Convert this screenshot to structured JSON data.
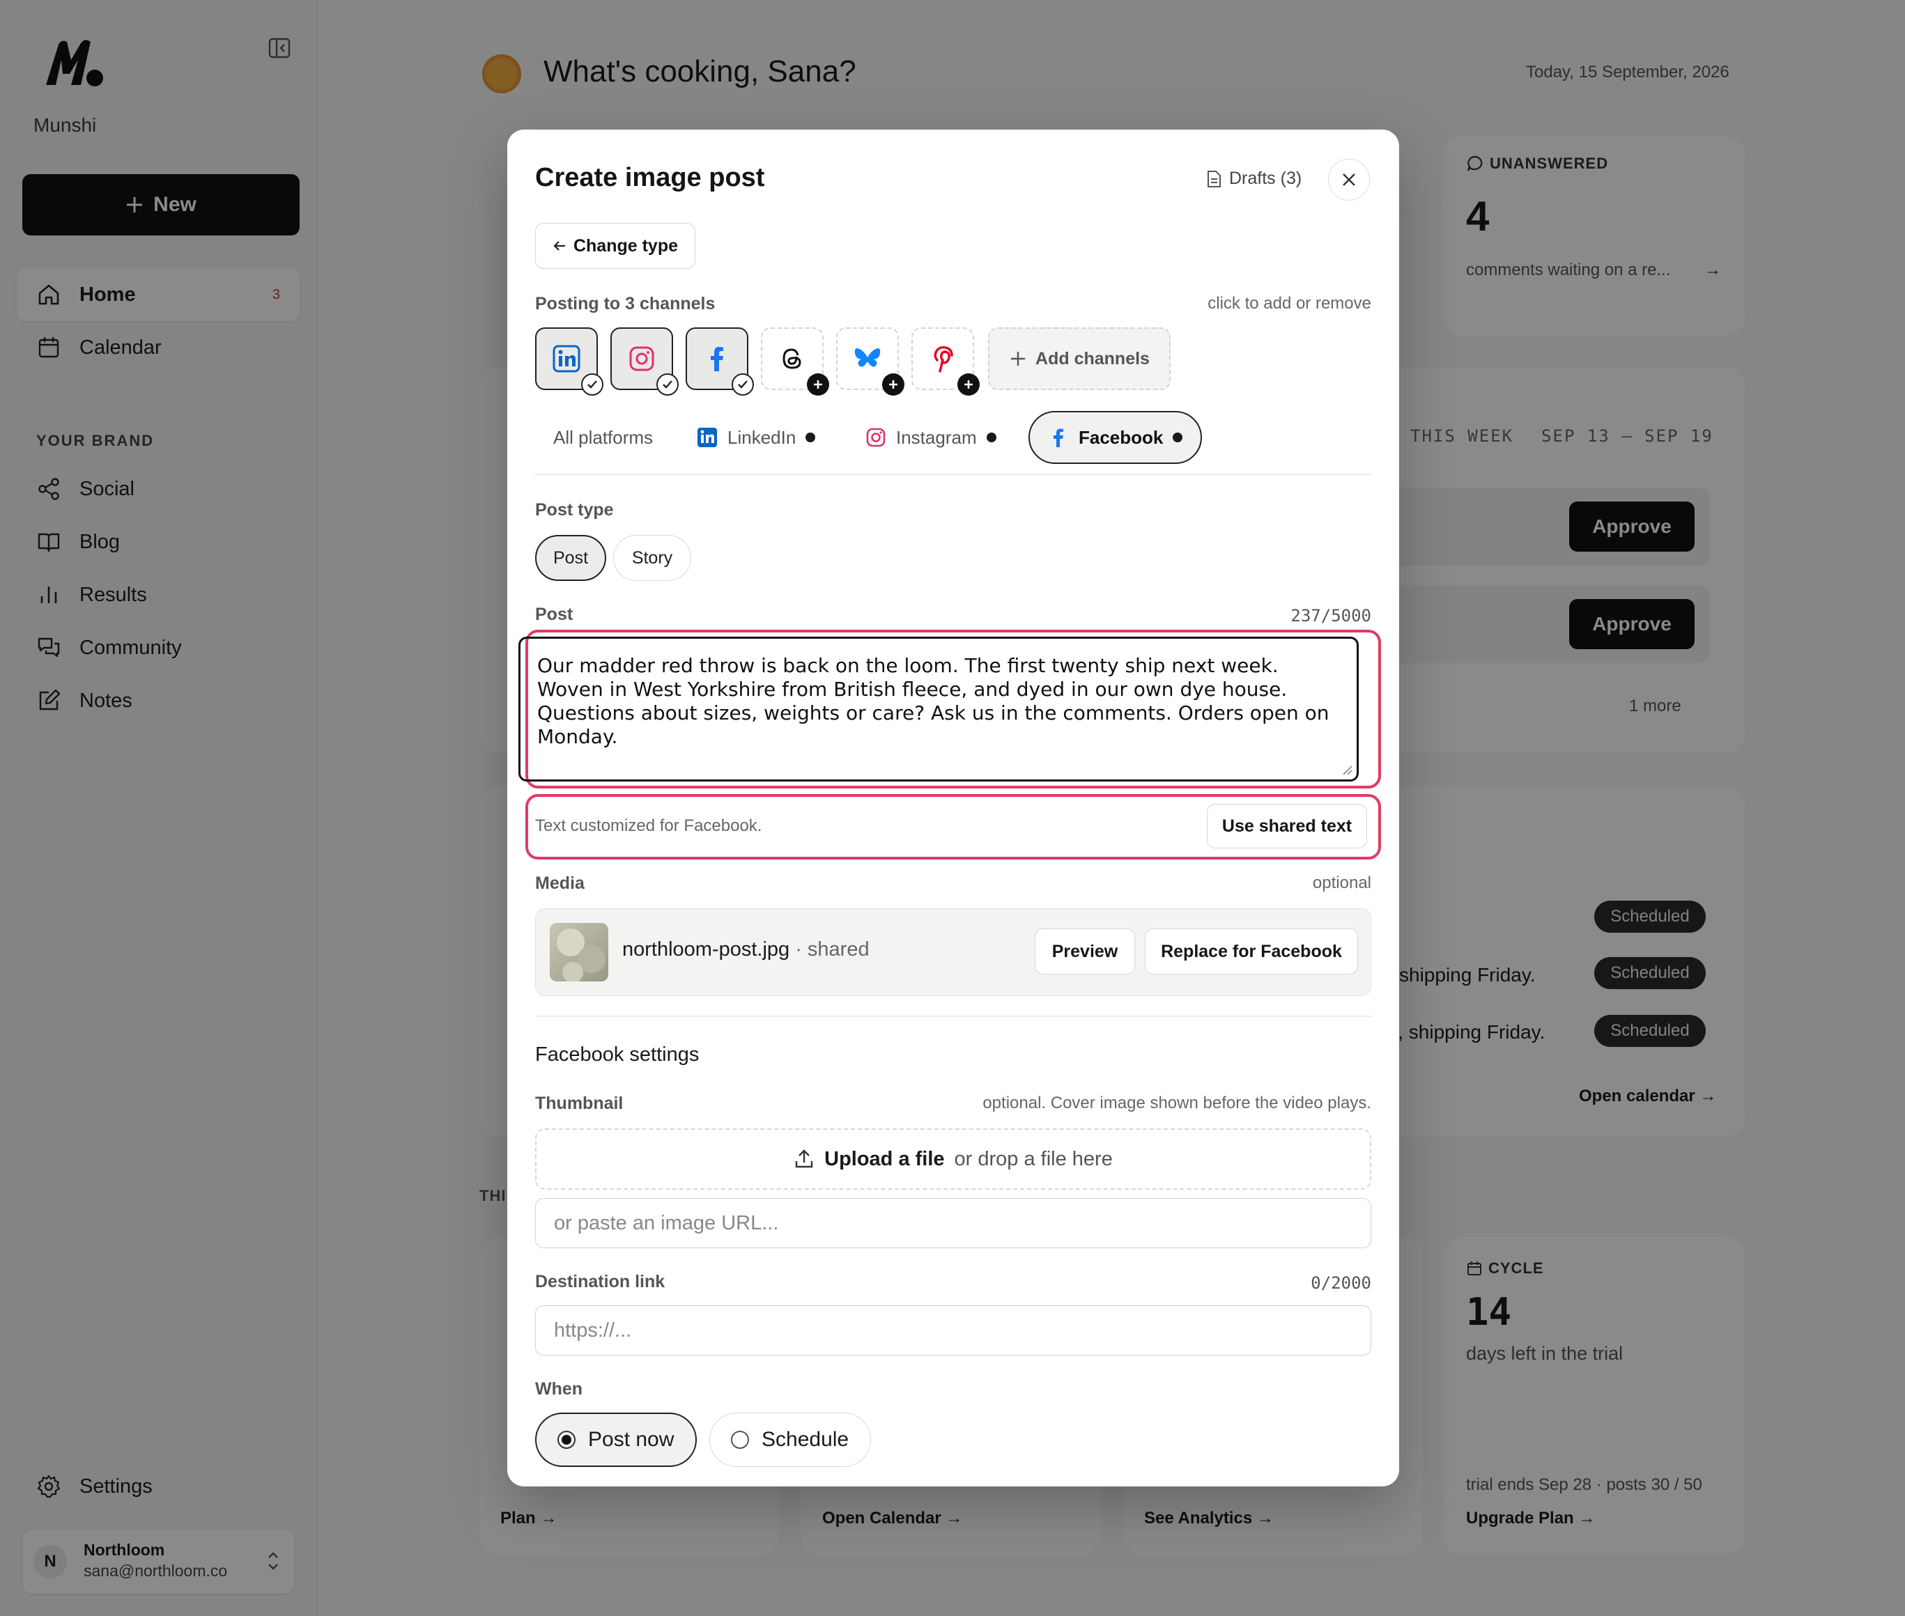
{
  "brand": {
    "name": "Munshi"
  },
  "sidebar": {
    "new_label": "New",
    "items": [
      {
        "label": "Home",
        "badge": "3",
        "icon": "home-icon"
      },
      {
        "label": "Calendar",
        "icon": "calendar-icon"
      }
    ],
    "section_label": "YOUR BRAND",
    "brand_items": [
      {
        "label": "Social",
        "icon": "share-icon"
      },
      {
        "label": "Blog",
        "icon": "book-icon"
      },
      {
        "label": "Results",
        "icon": "bar-chart-icon"
      },
      {
        "label": "Community",
        "icon": "chat-icon"
      },
      {
        "label": "Notes",
        "icon": "edit-icon"
      }
    ],
    "settings_label": "Settings",
    "account": {
      "initial": "N",
      "name": "Northloom",
      "email": "sana@northloom.co"
    }
  },
  "dashboard": {
    "greeting": "What's cooking, Sana?",
    "date": "Today, 15 September, 2026",
    "unanswered": {
      "kicker": "UNANSWERED",
      "value": "4",
      "text": "comments waiting on a re..."
    },
    "week": {
      "label": "THIS WEEK",
      "range": "SEP 13 – SEP 19"
    },
    "approve_label": "Approve",
    "more_text": "1 more",
    "scheduled_label": "Scheduled",
    "row_texts": [
      "shipping Friday.",
      "l, shipping Friday."
    ],
    "open_calendar_text": "Open calendar →",
    "section_partial": "THI",
    "cycle": {
      "kicker": "CYCLE",
      "value": "14",
      "text": "days left in the trial",
      "footer": "trial ends Sep 28 · posts 30 / 50",
      "link": "Upgrade Plan →"
    },
    "bottom_links": [
      "Plan →",
      "Open Calendar →",
      "See Analytics →"
    ]
  },
  "modal": {
    "title": "Create image post",
    "drafts_label": "Drafts (3)",
    "change_type_label": "Change type",
    "posting_label": "Posting to 3 channels",
    "posting_hint": "click to add or remove",
    "channels": [
      {
        "name": "linkedin-icon",
        "selected": true,
        "color": "#0a66c2"
      },
      {
        "name": "instagram-icon",
        "selected": true,
        "color": "#e1306c"
      },
      {
        "name": "facebook-icon",
        "selected": true,
        "color": "#1877f2"
      },
      {
        "name": "threads-icon",
        "selected": false,
        "color": "#111111"
      },
      {
        "name": "bluesky-icon",
        "selected": false,
        "color": "#1185fe"
      },
      {
        "name": "pinterest-icon",
        "selected": false,
        "color": "#e60023"
      }
    ],
    "add_channels_label": "Add channels",
    "tabs": [
      "All platforms",
      "LinkedIn",
      "Instagram",
      "Facebook"
    ],
    "post_type_label": "Post type",
    "post_types": [
      "Post",
      "Story"
    ],
    "post_label": "Post",
    "post_count": "237/5000",
    "post_text": "Our madder red throw is back on the loom. The first twenty ship next week. Woven in West Yorkshire from British fleece, and dyed in our own dye house. Questions about sizes, weights or care? Ask us in the comments. Orders open on Monday.",
    "customized_note": "Text customized for Facebook.",
    "use_shared_label": "Use shared text",
    "media_label": "Media",
    "media_hint": "optional",
    "media_file": "northloom-post.jpg",
    "media_shared": "· shared",
    "preview_label": "Preview",
    "replace_label": "Replace for Facebook",
    "fb_settings_label": "Facebook settings",
    "thumbnail_label": "Thumbnail",
    "thumbnail_hint": "optional. Cover image shown before the video plays.",
    "upload_label": "Upload a file",
    "upload_hint": "or drop a file here",
    "image_url_placeholder": "or paste an image URL...",
    "destination_label": "Destination link",
    "destination_count": "0/2000",
    "destination_placeholder": "https://...",
    "when_label": "When",
    "when_options": [
      "Post now",
      "Schedule"
    ],
    "highlight_color": "#e03b63"
  }
}
